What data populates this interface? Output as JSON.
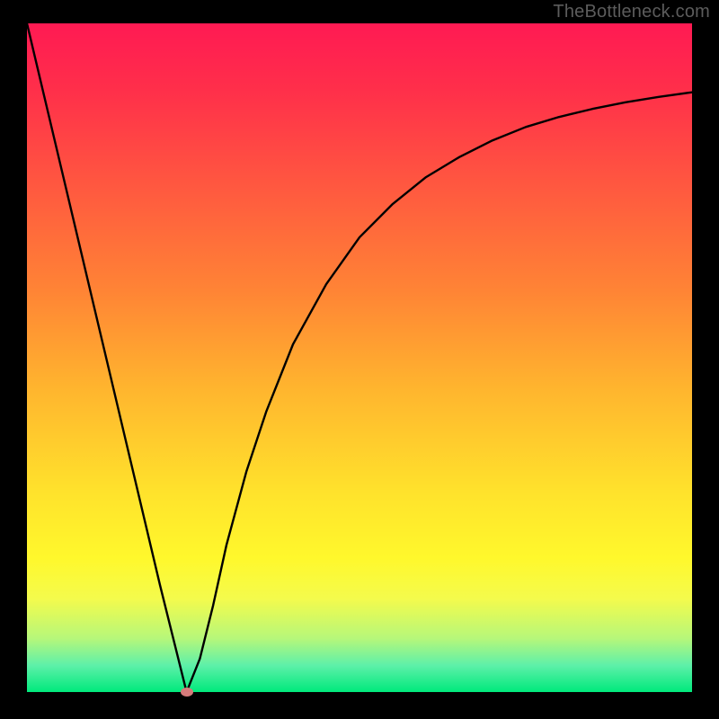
{
  "watermark": "TheBottleneck.com",
  "chart_data": {
    "type": "line",
    "title": "",
    "xlabel": "",
    "ylabel": "",
    "xlim": [
      0,
      100
    ],
    "ylim": [
      0,
      100
    ],
    "series": [
      {
        "name": "bottleneck-curve",
        "x": [
          0,
          5,
          10,
          15,
          20,
          24,
          26,
          28,
          30,
          33,
          36,
          40,
          45,
          50,
          55,
          60,
          65,
          70,
          75,
          80,
          85,
          90,
          95,
          100
        ],
        "values": [
          100,
          79,
          58,
          37,
          16,
          0,
          5,
          13,
          22,
          33,
          42,
          52,
          61,
          68,
          73,
          77,
          80,
          82.5,
          84.5,
          86,
          87.2,
          88.2,
          89,
          89.7
        ]
      }
    ],
    "marker": {
      "x": 24,
      "y": 0,
      "color": "#d67b7b"
    },
    "background_gradient": {
      "top": "#ff1a53",
      "bottom": "#00e97c"
    }
  }
}
